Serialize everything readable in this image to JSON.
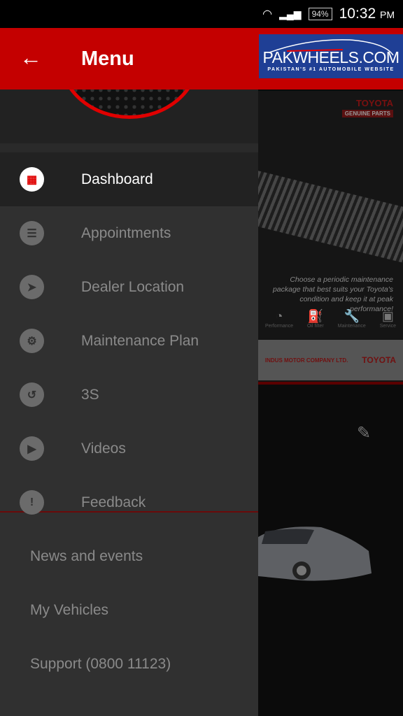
{
  "status": {
    "battery": "94%",
    "time": "10:32",
    "ampm": "PM"
  },
  "appbar": {
    "title": "Menu",
    "logo_main": "PAKWHEELS.COM",
    "logo_sub": "PAKISTAN'S #1 AUTOMOBILE WEBSITE"
  },
  "banner": {
    "brand": "TOYOTA",
    "badge": "GENUINE PARTS",
    "copy": "Choose a periodic maintenance package that best suits your Toyota's condition and keep it at peak performance!",
    "icons": [
      "Performance",
      "Oil filter",
      "Maintenance",
      "Service"
    ],
    "footer_left": "INDUS MOTOR COMPANY LTD.",
    "footer_right": "TOYOTA"
  },
  "menu": {
    "items": [
      {
        "label": "Dashboard",
        "icon": "dashboard-icon",
        "glyph": "▦"
      },
      {
        "label": "Appointments",
        "icon": "appointments-icon",
        "glyph": "☰"
      },
      {
        "label": "Dealer Location",
        "icon": "navigation-icon",
        "glyph": "➤"
      },
      {
        "label": "Maintenance Plan",
        "icon": "gear-wrench-icon",
        "glyph": "⚙"
      },
      {
        "label": "3S",
        "icon": "3s-replay-icon",
        "glyph": "↺"
      },
      {
        "label": "Videos",
        "icon": "play-icon",
        "glyph": "▶"
      },
      {
        "label": "Feedback",
        "icon": "feedback-icon",
        "glyph": "!"
      }
    ],
    "secondary": [
      "News and events",
      "My Vehicles",
      "Support (0800 11123)"
    ]
  },
  "colors": {
    "accent": "#c40000",
    "drawer": "#303030"
  }
}
